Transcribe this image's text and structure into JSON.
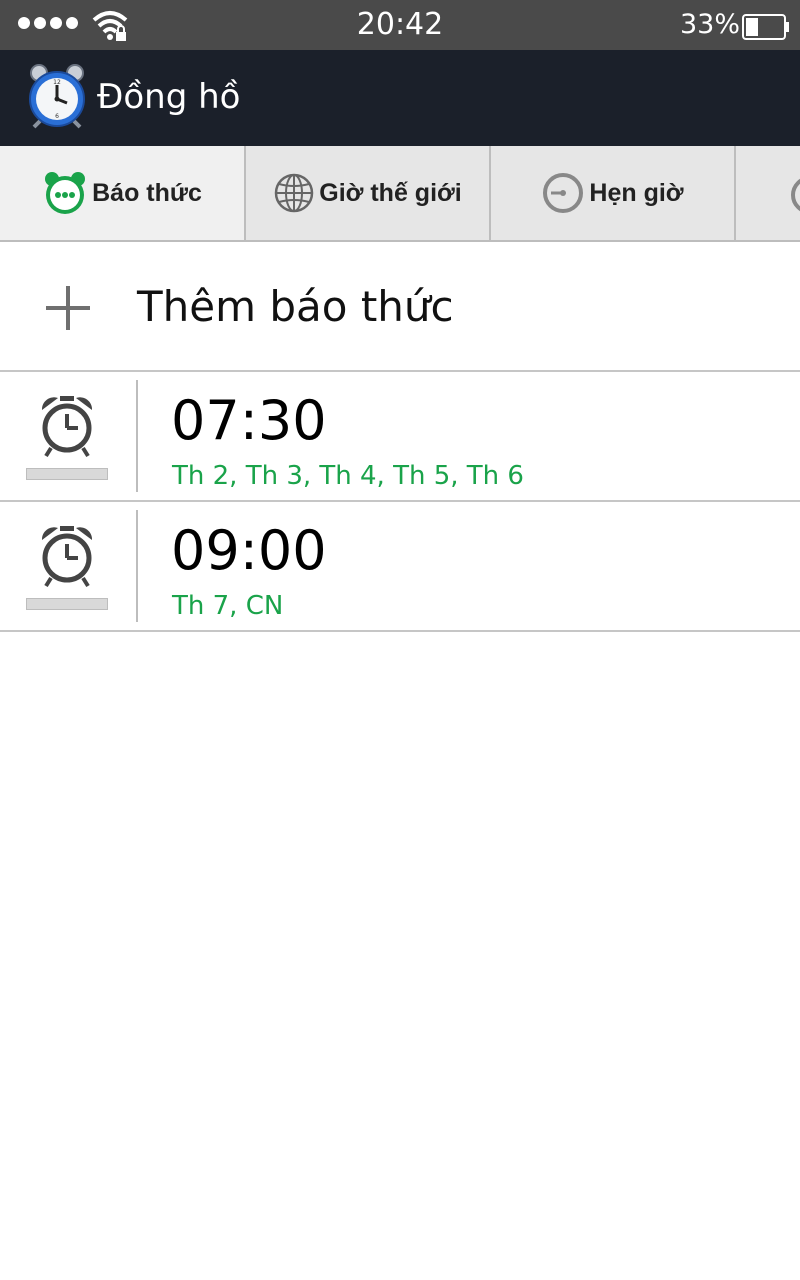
{
  "status_bar": {
    "time": "20:42",
    "battery_percent": "33%",
    "battery_level": 0.33
  },
  "app": {
    "title": "Đồng hồ"
  },
  "tabs": [
    {
      "label": "Báo thức",
      "icon": "alarm-clock-icon",
      "active": true
    },
    {
      "label": "Giờ thế giới",
      "icon": "globe-icon",
      "active": false
    },
    {
      "label": "Hẹn giờ",
      "icon": "timer-icon",
      "active": false
    },
    {
      "label": "",
      "icon": "stopwatch-icon",
      "active": false
    }
  ],
  "add_alarm": {
    "label": "Thêm báo thức"
  },
  "alarms": [
    {
      "time": "07:30",
      "days": "Th 2, Th 3, Th 4, Th 5, Th 6",
      "enabled": false
    },
    {
      "time": "09:00",
      "days": "Th 7, CN",
      "enabled": false
    }
  ],
  "colors": {
    "accent": "#1aa34a",
    "app_bar": "#1b202a",
    "status_bar": "#4a4a4a"
  }
}
